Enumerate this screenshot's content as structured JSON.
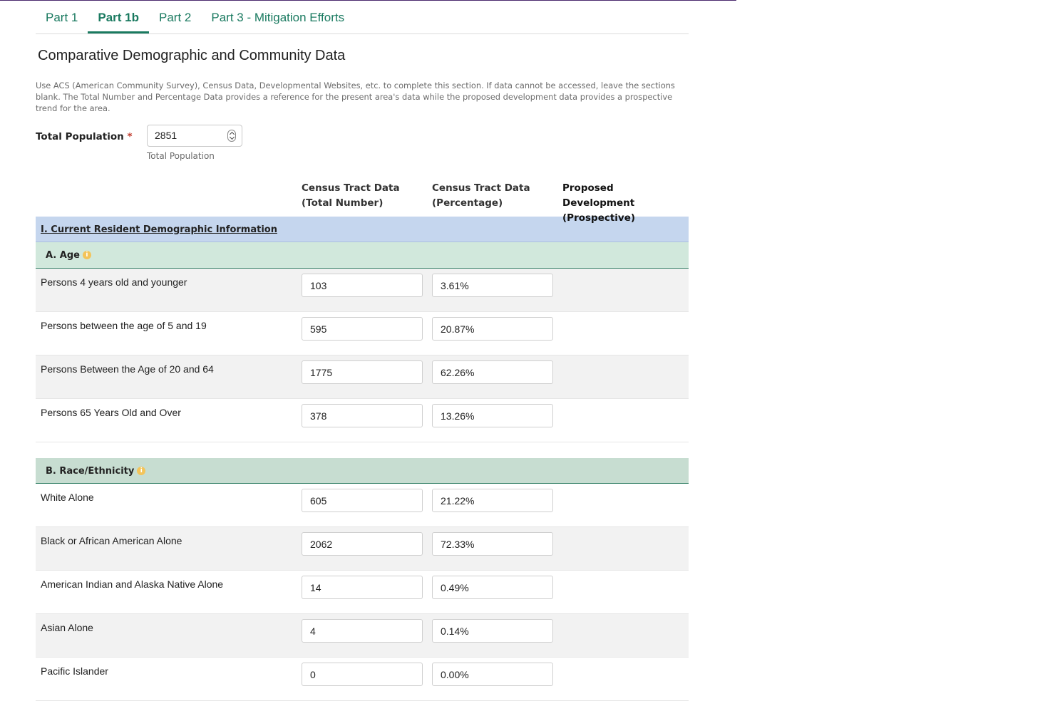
{
  "tabs": [
    "Part 1",
    "Part 1b",
    "Part 2",
    "Part 3 - Mitigation Efforts"
  ],
  "active_tab": "Part 1b",
  "page_title": "Comparative Demographic and Community Data",
  "intro": "Use ACS (American Community Survey), Census Data, Developmental Websites, etc. to complete this section. If data cannot be accessed, leave the sections blank. The Total Number and Percentage Data provides a reference for the present area's data while the proposed development data provides a prospective trend for the area.",
  "total_population": {
    "label": "Total Population",
    "required_mark": "*",
    "value": "2851",
    "help": "Total Population"
  },
  "columns": {
    "total_number": [
      "Census Tract Data",
      "(Total Number)"
    ],
    "percentage": [
      "Census Tract Data",
      "(Percentage)"
    ],
    "proposed": [
      "Proposed Development",
      "(Prospective)"
    ]
  },
  "section_title": "I. Current Resident Demographic Information",
  "age": {
    "title": "A. Age",
    "info_icon": "info-icon",
    "rows": [
      {
        "label": "Persons 4 years old and younger",
        "number": "103",
        "percent": "3.61%"
      },
      {
        "label": "Persons between the age of 5 and 19",
        "number": "595",
        "percent": "20.87%"
      },
      {
        "label": "Persons Between the Age of 20 and 64",
        "number": "1775",
        "percent": "62.26%"
      },
      {
        "label": "Persons 65 Years Old and Over",
        "number": "378",
        "percent": "13.26%"
      }
    ]
  },
  "race": {
    "title": "B. Race/Ethnicity",
    "info_icon": "info-icon",
    "rows": [
      {
        "label": "White Alone",
        "number": "605",
        "percent": "21.22%"
      },
      {
        "label": "Black or African American Alone",
        "number": "2062",
        "percent": "72.33%"
      },
      {
        "label": "American Indian and Alaska Native Alone",
        "number": "14",
        "percent": "0.49%"
      },
      {
        "label": "Asian Alone",
        "number": "4",
        "percent": "0.14%"
      },
      {
        "label": "Pacific Islander",
        "number": "0",
        "percent": "0.00%"
      }
    ]
  },
  "colors": {
    "accent": "#1a7a60",
    "section_bg": "#c5d6ee",
    "subsection_bg": "#d1e8dc",
    "info_icon": "#f3c45a",
    "required": "#c0392b"
  }
}
